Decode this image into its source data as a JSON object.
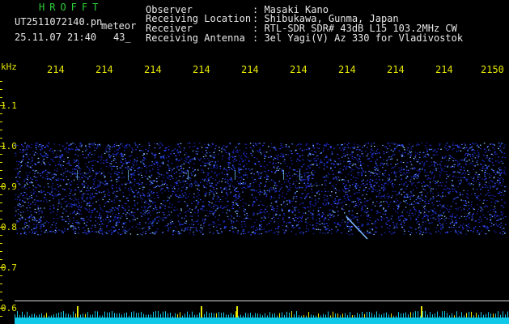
{
  "header": {
    "software": "HROFFT",
    "filename": "UT2511072140.pn",
    "tag": "meteor",
    "datetime": "25.11.07 21:40",
    "count": "43_",
    "fields": [
      {
        "label": "Observer",
        "value": ": Masaki Kano"
      },
      {
        "label": "Receiving Location",
        "value": ": Shibukawa, Gunma, Japan"
      },
      {
        "label": "Receiver",
        "value": ": RTL-SDR SDR# 43dB L15 103.2MHz CW"
      },
      {
        "label": "Receiving Antenna",
        "value": ": 3el Yagi(V) Az 330 for Vladivostok"
      }
    ]
  },
  "chart_data": {
    "type": "heatmap",
    "ylabel": "kHz",
    "y_ticks": [
      "1.1",
      "1.0",
      "0.9",
      "0.8",
      "0.7",
      "0.6"
    ],
    "x_ticks": [
      "214",
      "214",
      "214",
      "214",
      "214",
      "214",
      "214",
      "214",
      "214",
      "2150"
    ],
    "ylim": [
      0.6,
      1.15
    ],
    "noise_band_khz": [
      0.79,
      1.0
    ],
    "meteor_trace": {
      "start_khz": 0.825,
      "end_khz": 0.77
    }
  },
  "colors": {
    "background": "#000000",
    "signal": "#2b3bff",
    "axis_text": "#e6e600",
    "header_text": "#e8e8e8",
    "software_text": "#2fd13a"
  }
}
